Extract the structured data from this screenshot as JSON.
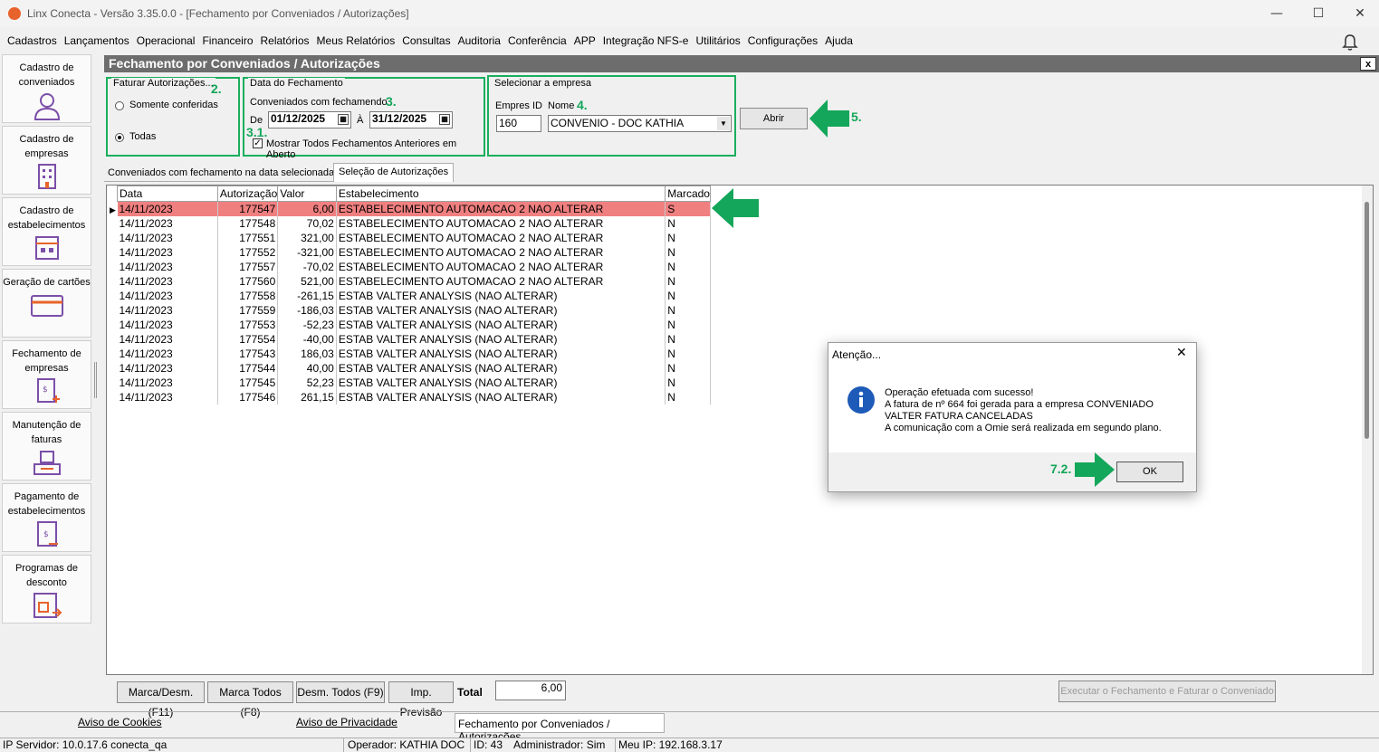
{
  "window": {
    "title": "Linx Conecta - Versão 3.35.0.0 - [Fechamento por Conveniados / Autorizações]",
    "minimize": "—",
    "maximize": "☐",
    "close": "✕"
  },
  "menu": [
    "Cadastros",
    "Lançamentos",
    "Operacional",
    "Financeiro",
    "Relatórios",
    "Meus Relatórios",
    "Consultas",
    "Auditoria",
    "Conferência",
    "APP",
    "Integração NFS-e",
    "Utilitários",
    "Configurações",
    "Ajuda"
  ],
  "sidebar": [
    {
      "label": "Cadastro de conveniados",
      "icon": "person-icon"
    },
    {
      "label": "Cadastro de empresas",
      "icon": "building-icon"
    },
    {
      "label": "Cadastro de estabelecimentos",
      "icon": "store-icon"
    },
    {
      "label": "Geração de cartões",
      "icon": "card-icon"
    },
    {
      "label": "Fechamento de empresas",
      "icon": "invoice-add-icon"
    },
    {
      "label": "Manutenção de faturas",
      "icon": "tray-icon"
    },
    {
      "label": "Pagamento de estabelecimentos",
      "icon": "payment-icon"
    },
    {
      "label": "Programas de desconto",
      "icon": "discount-icon"
    }
  ],
  "form": {
    "title": "Fechamento por Conveniados / Autorizações",
    "close": "x",
    "faturar": {
      "title": "Faturar Autorizações...",
      "opt1": "Somente conferidas",
      "opt2": "Todas",
      "selected": "Todas",
      "step": "2."
    },
    "data": {
      "title": "Data do Fechamento",
      "label": "Conveniados com fechamendo",
      "step": "3.",
      "de_label": "De",
      "de": "01/12/2025",
      "a_label": "À",
      "a": "31/12/2025",
      "check_label": "Mostrar Todos Fechamentos Anteriores em Aberto",
      "checked": true,
      "step_check": "3.1."
    },
    "empresa": {
      "title": "Selecionar a empresa",
      "id_label": "Empres ID",
      "id": "160",
      "nome_label": "Nome",
      "nome": "CONVENIO -  DOC KATHIA",
      "step": "4."
    },
    "abrir": "Abrir",
    "abrir_step": "5.",
    "tabs": [
      "Conveniados com fechamento na data selecionada",
      "Seleção de Autorizações"
    ],
    "active_tab": 1
  },
  "grid": {
    "columns": [
      "Data",
      "Autorização",
      "Valor",
      "Estabelecimento",
      "Marcado"
    ],
    "rows": [
      [
        "14/11/2023",
        "177547",
        "6,00",
        "ESTABELECIMENTO AUTOMACAO 2 NAO ALTERAR",
        "S"
      ],
      [
        "14/11/2023",
        "177548",
        "70,02",
        "ESTABELECIMENTO AUTOMACAO 2 NAO ALTERAR",
        "N"
      ],
      [
        "14/11/2023",
        "177551",
        "321,00",
        "ESTABELECIMENTO AUTOMACAO 2 NAO ALTERAR",
        "N"
      ],
      [
        "14/11/2023",
        "177552",
        "-321,00",
        "ESTABELECIMENTO AUTOMACAO 2 NAO ALTERAR",
        "N"
      ],
      [
        "14/11/2023",
        "177557",
        "-70,02",
        "ESTABELECIMENTO AUTOMACAO 2 NAO ALTERAR",
        "N"
      ],
      [
        "14/11/2023",
        "177560",
        "521,00",
        "ESTABELECIMENTO AUTOMACAO 2 NAO ALTERAR",
        "N"
      ],
      [
        "14/11/2023",
        "177558",
        "-261,15",
        "ESTAB VALTER ANALYSIS (NAO ALTERAR)",
        "N"
      ],
      [
        "14/11/2023",
        "177559",
        "-186,03",
        "ESTAB VALTER ANALYSIS (NAO ALTERAR)",
        "N"
      ],
      [
        "14/11/2023",
        "177553",
        "-52,23",
        "ESTAB VALTER ANALYSIS (NAO ALTERAR)",
        "N"
      ],
      [
        "14/11/2023",
        "177554",
        "-40,00",
        "ESTAB VALTER ANALYSIS (NAO ALTERAR)",
        "N"
      ],
      [
        "14/11/2023",
        "177543",
        "186,03",
        "ESTAB VALTER ANALYSIS (NAO ALTERAR)",
        "N"
      ],
      [
        "14/11/2023",
        "177544",
        "40,00",
        "ESTAB VALTER ANALYSIS (NAO ALTERAR)",
        "N"
      ],
      [
        "14/11/2023",
        "177545",
        "52,23",
        "ESTAB VALTER ANALYSIS (NAO ALTERAR)",
        "N"
      ],
      [
        "14/11/2023",
        "177546",
        "261,15",
        "ESTAB VALTER ANALYSIS (NAO ALTERAR)",
        "N"
      ]
    ]
  },
  "bottom": {
    "marca_desm": "Marca/Desm. (F11)",
    "marca_todos": "Marca Todos (F8)",
    "desm_todos": "Desm. Todos (F9)",
    "imp_previsao": "Imp. Previsão",
    "total_label": "Total",
    "total": "6,00",
    "executar": "Executar o Fechamento e Faturar o Conveniado"
  },
  "dialog": {
    "title": "Atenção...",
    "line1": "Operação efetuada com sucesso!",
    "line2": "A fatura de nº 664 foi gerada para a empresa CONVENIADO",
    "line3": "VALTER FATURA CANCELADAS",
    "line4": "A comunicação com a Omie será realizada em segundo plano.",
    "ok": "OK",
    "step": "7.2.",
    "close": "✕"
  },
  "footer": {
    "cookies": "Aviso de Cookies",
    "privacidade": "Aviso de Privacidade",
    "tab": "Fechamento por Conveniados / Autorizações"
  },
  "status": {
    "servidor": "IP Servidor: 10.0.17.6 conecta_qa",
    "operador": "Operador: KATHIA DOC",
    "id": "ID: 43",
    "admin": "Administrador: Sim",
    "ip": "Meu IP: 192.168.3.17"
  },
  "colors": {
    "accent_green": "#14a65a",
    "selected_row": "#f08080",
    "header_gray": "#6d6d6d"
  }
}
